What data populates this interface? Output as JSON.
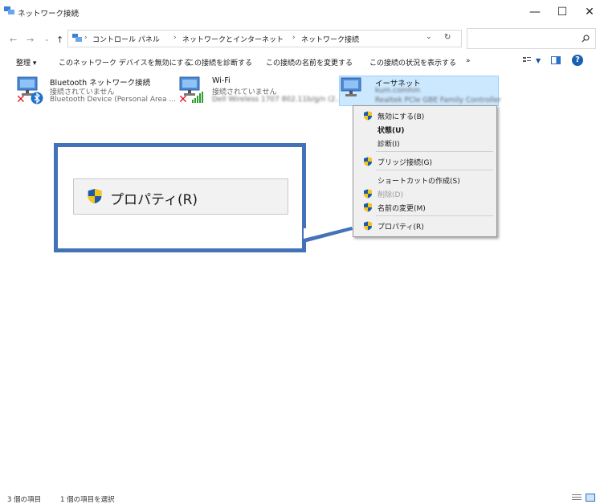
{
  "window": {
    "title": "ネットワーク接続",
    "controls": [
      "—",
      "☐",
      "✕"
    ]
  },
  "address": {
    "breadcrumb": [
      "コントロール パネル",
      "ネットワークとインターネット",
      "ネットワーク接続"
    ],
    "separator": "›"
  },
  "toolbar": {
    "organize": "整理 ▾",
    "commands": [
      "このネットワーク デバイスを無効にする",
      "この接続を診断する",
      "この接続の名前を変更する",
      "この接続の状況を表示する"
    ],
    "more": "»"
  },
  "connections": [
    {
      "name": "Bluetooth ネットワーク接続",
      "status": "接続されていません",
      "device": "Bluetooth Device (Personal Area ..."
    },
    {
      "name": "Wi-Fi",
      "status": "接続されていません",
      "device": "Dell Wireless 1707 802.11b/g/n (2...."
    },
    {
      "name": "イーサネット",
      "status": "kum.comhm",
      "device": "Realtek PCIe GBE Family Controller"
    }
  ],
  "context_menu": {
    "items": [
      {
        "label": "無効にする(B)",
        "shield": true,
        "bold": false,
        "disabled": false
      },
      {
        "label": "状態(U)",
        "shield": false,
        "bold": true,
        "disabled": false
      },
      {
        "label": "診断(I)",
        "shield": false,
        "bold": false,
        "disabled": false
      },
      {
        "label": "ブリッジ接続(G)",
        "shield": true,
        "bold": false,
        "disabled": false
      },
      {
        "label": "ショートカットの作成(S)",
        "shield": false,
        "bold": false,
        "disabled": false
      },
      {
        "label": "削除(D)",
        "shield": true,
        "bold": false,
        "disabled": true
      },
      {
        "label": "名前の変更(M)",
        "shield": true,
        "bold": false,
        "disabled": false
      },
      {
        "label": "プロパティ(R)",
        "shield": true,
        "bold": false,
        "disabled": false
      }
    ]
  },
  "callout": {
    "zoom_label": "プロパティ(R)",
    "border_color": "#4472b8"
  },
  "status": {
    "item_count": "3 個の項目",
    "selected_count": "1 個の項目を選択"
  },
  "colors": {
    "selection_bg": "#cce8ff",
    "shield_blue": "#1e5aa8",
    "shield_yellow": "#f5c518",
    "error_red": "#e81123",
    "signal_green": "#2e9e2e"
  }
}
